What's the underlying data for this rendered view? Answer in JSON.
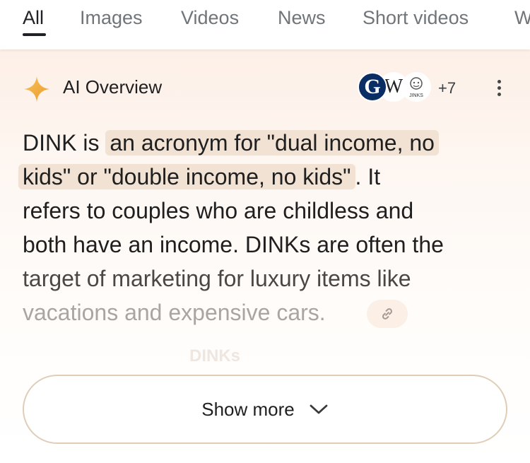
{
  "tabs": [
    {
      "label": "All",
      "active": true
    },
    {
      "label": "Images"
    },
    {
      "label": "Videos"
    },
    {
      "label": "News"
    },
    {
      "label": "Short videos"
    },
    {
      "label": "W"
    }
  ],
  "overview": {
    "title": "AI Overview",
    "title_icon": "sparkle-icon",
    "sources": [
      {
        "icon": "guardian-logo",
        "glyph": "G"
      },
      {
        "icon": "wikipedia-logo",
        "glyph": "W"
      },
      {
        "icon": "jinks-logo",
        "glyph": "JINKS"
      }
    ],
    "more_sources_count": "+7",
    "menu_icon": "more-vert-icon",
    "lines": {
      "l1_plain": "DINK is ",
      "l1_hl": "an acronym for \"dual income, no",
      "l2_hl": "kids\" or \"double income, no kids\"",
      "l2_plain": ". It",
      "l3": "refers to couples who are childless and",
      "l4": "both have an income. DINKs are often the",
      "l5": "target of marketing for luxury items like",
      "l6": "vacations and expensive cars."
    },
    "link_icon": "link-icon",
    "faded_heading": "DINKs"
  },
  "show_more": {
    "label": "Show more",
    "icon": "chevron-down-icon"
  },
  "colors": {
    "highlight": "#f1e2d3",
    "accent_gold": "#f2b23a",
    "panel_bg": "#fdf0e7"
  }
}
